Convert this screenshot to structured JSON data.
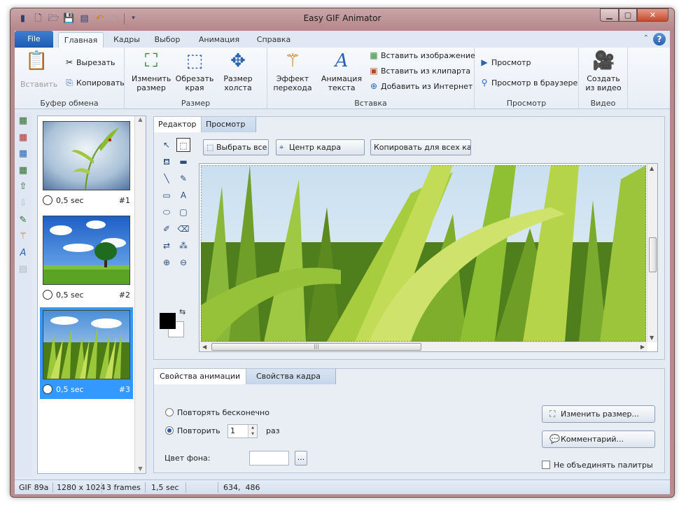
{
  "window": {
    "title": "Easy GIF Animator"
  },
  "quick_access": [
    {
      "icon": "app-icon",
      "glyph": "▮"
    },
    {
      "icon": "new-file-icon",
      "glyph": "▯"
    },
    {
      "icon": "open-folder-icon",
      "glyph": "▭"
    },
    {
      "icon": "save-icon",
      "glyph": "▣"
    },
    {
      "icon": "save-all-icon",
      "glyph": "▤"
    },
    {
      "icon": "undo-icon",
      "glyph": "↶"
    },
    {
      "icon": "redo-icon",
      "glyph": "↷"
    },
    {
      "icon": "customize-dropdown-icon",
      "glyph": "▾"
    }
  ],
  "ribbon": {
    "file_tab": "File",
    "tabs": [
      "Главная",
      "Кадры",
      "Выбор",
      "Анимация",
      "Справка"
    ],
    "active_tab": "Главная",
    "groups": {
      "clipboard": {
        "label": "Буфер обмена",
        "paste": "Вставить",
        "cut": "Вырезать",
        "copy": "Копировать"
      },
      "size": {
        "label": "Размер",
        "resize": [
          "Изменить",
          "размер"
        ],
        "crop": [
          "Обрезать",
          "края"
        ],
        "canvas": [
          "Размер",
          "холста"
        ]
      },
      "insert": {
        "label": "Вставка",
        "transition": [
          "Эффект",
          "перехода"
        ],
        "text_anim": [
          "Анимация",
          "текста"
        ],
        "insert_image": "Вставить изображение",
        "insert_clipart": "Вставить из клипарта",
        "add_internet": "Добавить из Интернет"
      },
      "preview": {
        "label": "Просмотр",
        "preview": "Просмотр",
        "preview_browser": "Просмотр в браузере"
      },
      "video": {
        "label": "Видео",
        "create": [
          "Создать",
          "из видео"
        ]
      }
    }
  },
  "frames": [
    {
      "duration": "0,5 sec",
      "number": "#1",
      "selected": false
    },
    {
      "duration": "0,5 sec",
      "number": "#2",
      "selected": false
    },
    {
      "duration": "0,5 sec",
      "number": "#3",
      "selected": true
    }
  ],
  "editor": {
    "tabs": [
      "Редактор",
      "Просмотр"
    ],
    "buttons": {
      "select_all": "Выбрать все",
      "center_frame": "Центр кадра",
      "copy_all_frames": "Копировать для всех кадров"
    }
  },
  "props": {
    "tabs": [
      "Свойства анимации",
      "Свойства кадра"
    ],
    "repeat_forever": "Повторять бесконечно",
    "repeat": "Повторить",
    "repeat_count": "1",
    "times": "раз",
    "bg_color": "Цвет фона:",
    "dots": "...",
    "resize_btn": "Изменить размер...",
    "comment_btn": "Комментарий...",
    "no_merge_palettes": "Не объединять палитры"
  },
  "status": {
    "format": "GIF 89a",
    "dimensions": "1280 x 1024",
    "frames": "3 frames",
    "duration": "1,5 sec",
    "coords": "634,  486"
  },
  "colors": {
    "selection": "#3399ff",
    "file_tab": "#1d5bb0",
    "titlebar": "#b98d90"
  }
}
